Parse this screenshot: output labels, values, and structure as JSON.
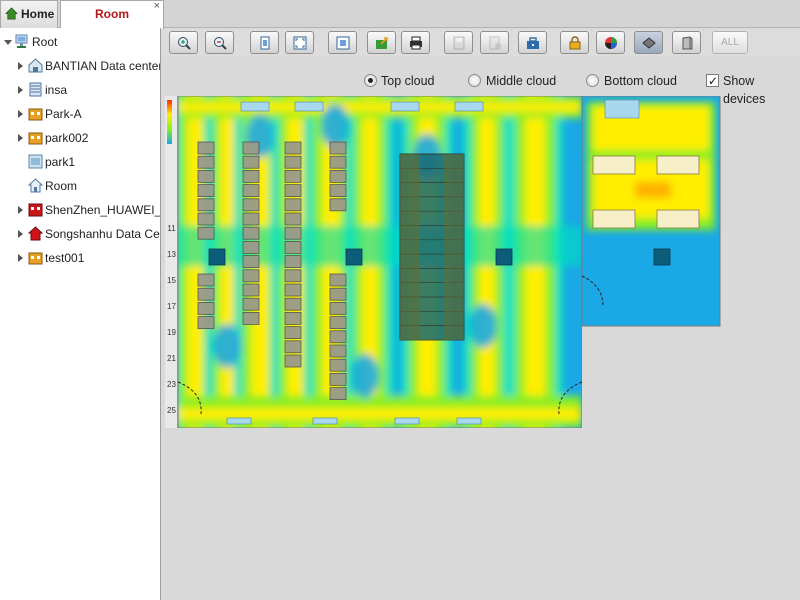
{
  "tabs": [
    {
      "label": "Home",
      "icon": "home-icon",
      "active": false
    },
    {
      "label": "Room",
      "icon": "close-icon",
      "active": true,
      "color": "#b0161b"
    }
  ],
  "tree": {
    "root": {
      "label": "Root",
      "icon": "computer-icon",
      "expanded": true
    },
    "children": [
      {
        "label": "BANTIAN Data center",
        "icon": "building-icon",
        "expandable": true
      },
      {
        "label": "insa",
        "icon": "server-icon",
        "expandable": true
      },
      {
        "label": "Park-A",
        "icon": "park-icon",
        "expandable": true
      },
      {
        "label": "park002",
        "icon": "park-icon",
        "expandable": true
      },
      {
        "label": "park1",
        "icon": "floor-icon",
        "expandable": false
      },
      {
        "label": "Room",
        "icon": "house-icon",
        "expandable": false
      },
      {
        "label": "ShenZhen_HUAWEI_H",
        "icon": "red-building-icon",
        "expandable": true
      },
      {
        "label": "Songshanhu Data Cen",
        "icon": "red-house-icon",
        "expandable": true
      },
      {
        "label": "test001",
        "icon": "park-icon",
        "expandable": true
      }
    ]
  },
  "toolbar": {
    "buttons": [
      {
        "name": "zoom-in-button",
        "icon": "zoom-in-icon"
      },
      {
        "name": "zoom-out-button",
        "icon": "zoom-out-icon"
      },
      {
        "name": "fit-page-button",
        "icon": "fit-page-icon"
      },
      {
        "name": "fullscreen-button",
        "icon": "fullscreen-icon"
      },
      {
        "name": "fit-window-button",
        "icon": "fit-window-icon"
      },
      {
        "name": "export-button",
        "icon": "export-icon"
      },
      {
        "name": "print-button",
        "icon": "printer-icon"
      },
      {
        "name": "save-button",
        "icon": "save-icon",
        "disabled": true
      },
      {
        "name": "settings-button",
        "icon": "document-gear-icon",
        "disabled": true
      },
      {
        "name": "toolbox-button",
        "icon": "toolbox-icon"
      },
      {
        "name": "lock-button",
        "icon": "lock-icon"
      },
      {
        "name": "color-button",
        "icon": "color-wheel-icon"
      },
      {
        "name": "cloud-view-button",
        "icon": "layer-icon",
        "active": true
      },
      {
        "name": "cabinet-view-button",
        "icon": "cabinet-icon"
      }
    ],
    "all_label": "ALL"
  },
  "options": {
    "top_cloud": {
      "label": "Top cloud",
      "selected": true
    },
    "middle_cloud": {
      "label": "Middle cloud",
      "selected": false
    },
    "bottom_cloud": {
      "label": "Bottom cloud",
      "selected": false
    },
    "show_devices": {
      "label": "Show devices",
      "checked": true
    }
  },
  "map": {
    "ruler_labels": [
      "11",
      "13",
      "15",
      "17",
      "19",
      "21",
      "23",
      "25"
    ],
    "colors": {
      "hot": "#ff2a00",
      "warm": "#ffee00",
      "mild": "#88ee22",
      "cool": "#00e0c0",
      "cold": "#1aa8e6",
      "cabinet": "#9a9a8a",
      "device": "#0c5d7a"
    }
  }
}
